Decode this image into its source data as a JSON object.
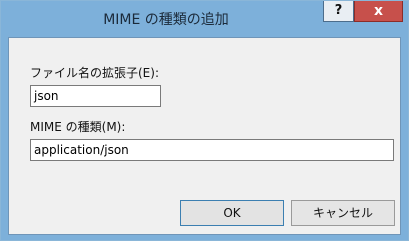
{
  "dialog": {
    "title": "MIME の種類の追加",
    "help_label": "?",
    "close_label": "x"
  },
  "form": {
    "extension_label": "ファイル名の拡張子(E):",
    "extension_value": "json",
    "mime_label": "MIME の種類(M):",
    "mime_value": "application/json"
  },
  "buttons": {
    "ok_label": "OK",
    "cancel_label": "キャンセル"
  }
}
